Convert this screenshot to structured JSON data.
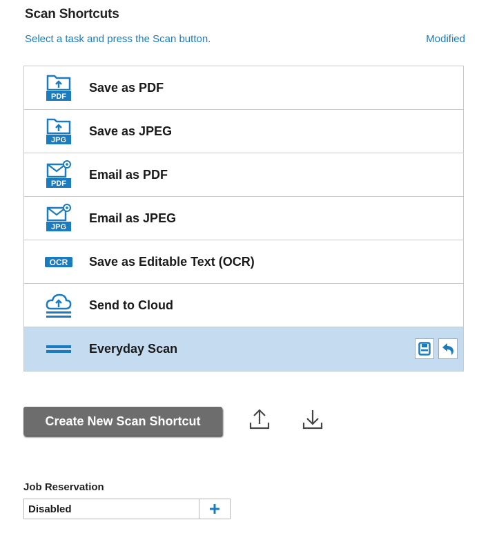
{
  "header": {
    "title": "Scan Shortcuts",
    "subtitle": "Select a task and press the Scan button.",
    "status": "Modified"
  },
  "shortcuts": [
    {
      "label": "Save as PDF",
      "icon": "folder-pdf-icon",
      "badge": "PDF"
    },
    {
      "label": "Save as JPEG",
      "icon": "folder-jpg-icon",
      "badge": "JPG"
    },
    {
      "label": "Email as PDF",
      "icon": "email-pdf-icon",
      "badge": "PDF"
    },
    {
      "label": "Email as JPEG",
      "icon": "email-jpg-icon",
      "badge": "JPG"
    },
    {
      "label": "Save as Editable Text (OCR)",
      "icon": "ocr-icon",
      "badge": "OCR"
    },
    {
      "label": "Send to Cloud",
      "icon": "cloud-upload-icon"
    },
    {
      "label": "Everyday Scan",
      "icon": "scan-lines-icon",
      "selected": true
    }
  ],
  "actions": {
    "create_label": "Create New Scan Shortcut"
  },
  "job_reservation": {
    "label": "Job Reservation",
    "value": "Disabled"
  },
  "colors": {
    "accent": "#1a7bbf",
    "selected_row": "#c5dbf0",
    "button_bg": "#6d6d6d"
  }
}
